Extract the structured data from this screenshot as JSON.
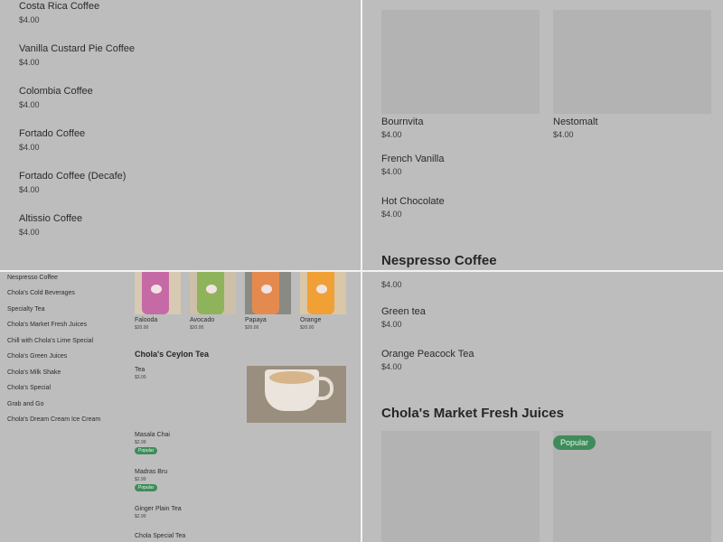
{
  "q1": {
    "items": [
      {
        "name": "Costa Rica Coffee",
        "price": "$4.00"
      },
      {
        "name": "Vanilla Custard Pie Coffee",
        "price": "$4.00"
      },
      {
        "name": "Colombia Coffee",
        "price": "$4.00"
      },
      {
        "name": "Fortado Coffee",
        "price": "$4.00"
      },
      {
        "name": "Fortado Coffee (Decafe)",
        "price": "$4.00"
      },
      {
        "name": "Altissio Coffee",
        "price": "$4.00"
      }
    ]
  },
  "q2": {
    "cards": [
      {
        "name": "Bournvita",
        "price": "$4.00"
      },
      {
        "name": "Nestomalt",
        "price": "$4.00"
      }
    ],
    "items": [
      {
        "name": "French Vanilla",
        "price": "$4.00"
      },
      {
        "name": "Hot Chocolate",
        "price": "$4.00"
      }
    ],
    "section_title": "Nespresso Coffee"
  },
  "q3": {
    "nav": [
      "Nespresso Coffee",
      "Chola's Cold Beverages",
      "Specialty Tea",
      "Chola's Market Fresh Juices",
      "Chill with Chola's Lime Special",
      "Chola's Green Juices",
      "Chola's Milk Shake",
      "Chola's Special",
      "Grab and Go",
      "Chola's Dream Cream Ice Cream"
    ],
    "juices": [
      {
        "name": "Falooda",
        "price": "$20.00",
        "color": "#c66aa6"
      },
      {
        "name": "Avocado",
        "price": "$20.00",
        "color": "#8fb35a"
      },
      {
        "name": "Papaya",
        "price": "$20.00",
        "color": "#e58a4e"
      },
      {
        "name": "Orange",
        "price": "$20.00",
        "color": "#f0a035"
      }
    ],
    "section_title": "Chola's Ceylon Tea",
    "items": [
      {
        "name": "Tea",
        "price": "$3.00"
      },
      {
        "name": "Masala Chai",
        "price": "$2.99",
        "badge": "Popular"
      },
      {
        "name": "Madras Bru",
        "price": "$2.99",
        "badge": "Popular"
      },
      {
        "name": "Ginger Plain Tea",
        "price": "$2.99"
      },
      {
        "name": "Chola Special Tea",
        "price": ""
      }
    ]
  },
  "q4": {
    "items": [
      {
        "name": "",
        "price": "$4.00"
      },
      {
        "name": "Green tea",
        "price": "$4.00"
      },
      {
        "name": "Orange Peacock Tea",
        "price": "$4.00"
      }
    ],
    "section_title": "Chola's Market Fresh Juices",
    "badge": "Popular"
  },
  "colors": {
    "badge": "#3f8c5a",
    "overlay": "#bdbdbd",
    "divider": "#f2f2f2"
  }
}
